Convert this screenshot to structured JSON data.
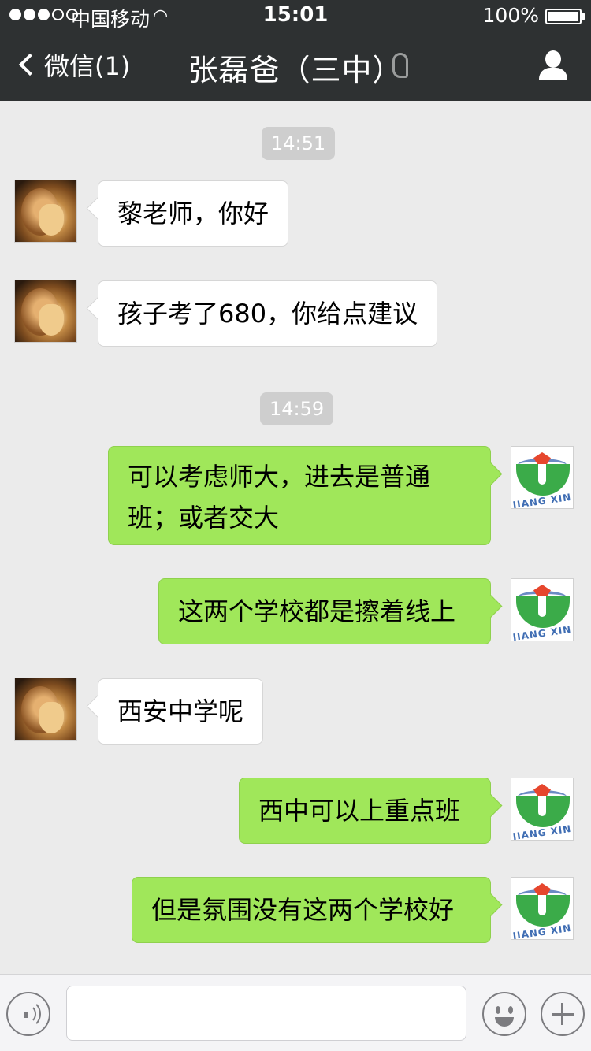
{
  "status_bar": {
    "signal_dots_filled": 3,
    "signal_dots_total": 5,
    "carrier": "中国移动",
    "wifi_icon": "wifi-icon",
    "time": "15:01",
    "battery": "100%"
  },
  "nav": {
    "back_label": "微信(1)",
    "title": "张磊爸（三中）",
    "icons": [
      "chevron-left-icon",
      "ear-icon",
      "profile-icon"
    ]
  },
  "timestamps": [
    "14:51",
    "14:59"
  ],
  "avatars": {
    "contact": "lion-avatar",
    "me": "jiangxin-logo-avatar",
    "me_logo_text": "JIANG XIN"
  },
  "messages": [
    {
      "from": "contact",
      "text": "黎老师，你好"
    },
    {
      "from": "contact",
      "text": "孩子考了680，你给点建议"
    },
    {
      "from": "me",
      "text": "可以考虑师大，进去是普通班；或者交大",
      "line1": "可以考虑师大，进去是普通",
      "line2": "班；或者交大"
    },
    {
      "from": "me",
      "text": "这两个学校都是擦着线上"
    },
    {
      "from": "contact",
      "text": "西安中学呢"
    },
    {
      "from": "me",
      "text": "西中可以上重点班"
    },
    {
      "from": "me",
      "text": "但是氛围没有这两个学校好"
    }
  ],
  "input_bar": {
    "voice_icon": "voice-icon",
    "input_value": "",
    "emoji_icon": "emoji-icon",
    "plus_icon": "plus-icon"
  },
  "colors": {
    "nav_bg": "#2e3132",
    "chat_bg": "#ebebeb",
    "bubble_out": "#a0e75a",
    "bubble_in": "#ffffff"
  }
}
